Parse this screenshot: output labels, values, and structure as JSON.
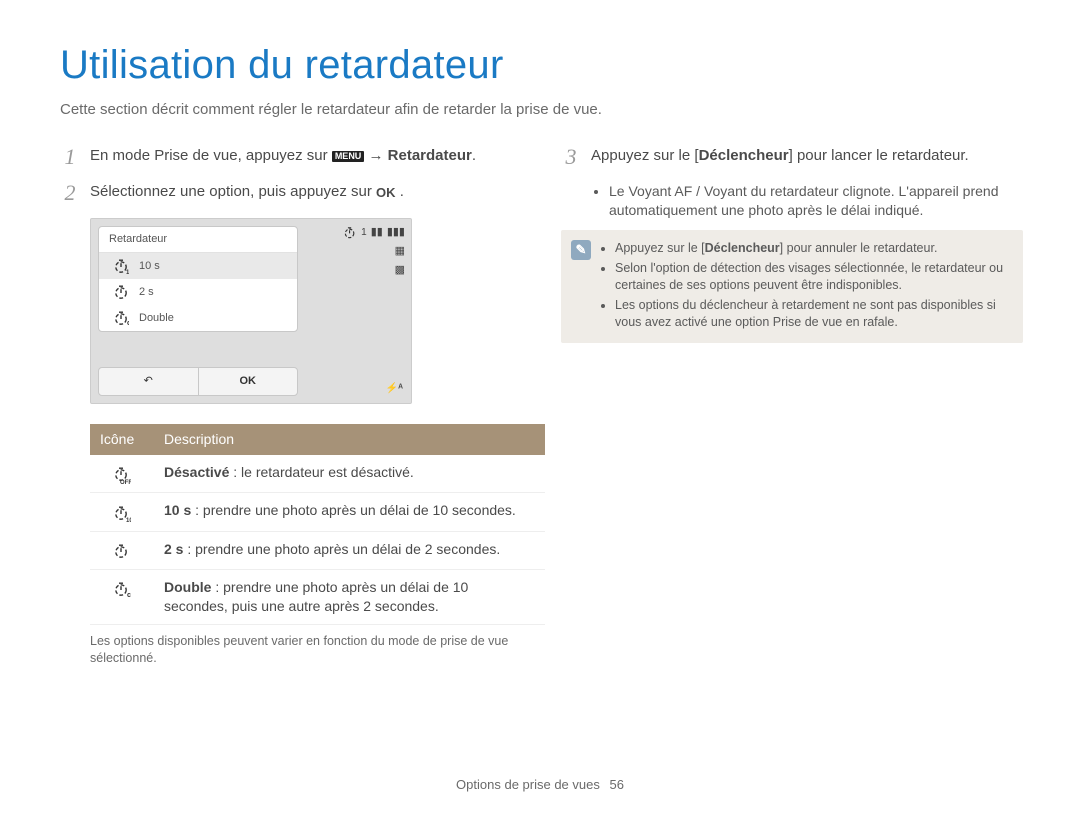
{
  "title": "Utilisation du retardateur",
  "intro": "Cette section décrit comment régler le retardateur afin de retarder la prise de vue.",
  "steps": {
    "s1_prefix": "En mode Prise de vue, appuyez sur ",
    "s1_menu": "MENU",
    "s1_arrow": " → ",
    "s1_bold": "Retardateur",
    "s1_suffix": ".",
    "s2_prefix": "Sélectionnez une option, puis appuyez sur ",
    "s2_ok": "OK",
    "s2_suffix": ".",
    "s3_prefix": "Appuyez sur le [",
    "s3_bold": "Déclencheur",
    "s3_suffix": "] pour lancer le retardateur.",
    "s3_b1": "Le Voyant AF / Voyant du retardateur clignote. L'appareil prend automatiquement une photo après le délai indiqué."
  },
  "lcd": {
    "title": "Retardateur",
    "opt1": "10 s",
    "opt2": "2 s",
    "opt3": "Double",
    "back": "↶",
    "ok": "OK",
    "one": "1",
    "corner": "⚡ᴬ"
  },
  "table": {
    "h1": "Icône",
    "h2": "Description",
    "r1_bold": "Désactivé",
    "r1_rest": " : le retardateur est désactivé.",
    "r2_bold": "10 s",
    "r2_rest": " : prendre une photo après un délai de 10 secondes.",
    "r3_bold": "2 s",
    "r3_rest": " : prendre une photo après un délai de 2 secondes.",
    "r4_bold": "Double",
    "r4_rest": " : prendre une photo après un délai de 10 secondes, puis une autre après 2 secondes."
  },
  "note_text": "Les options disponibles peuvent varier en fonction du mode de prise de vue sélectionné.",
  "info": {
    "b1_pre": "Appuyez sur le [",
    "b1_bold": "Déclencheur",
    "b1_post": "] pour annuler le retardateur.",
    "b2": "Selon l'option de détection des visages sélectionnée, le retardateur ou certaines de ses options peuvent être indisponibles.",
    "b3": "Les options du déclencheur à retardement ne sont pas disponibles si vous avez activé une option Prise de vue en rafale."
  },
  "footer": {
    "section": "Options de prise de vues",
    "page": "56"
  }
}
